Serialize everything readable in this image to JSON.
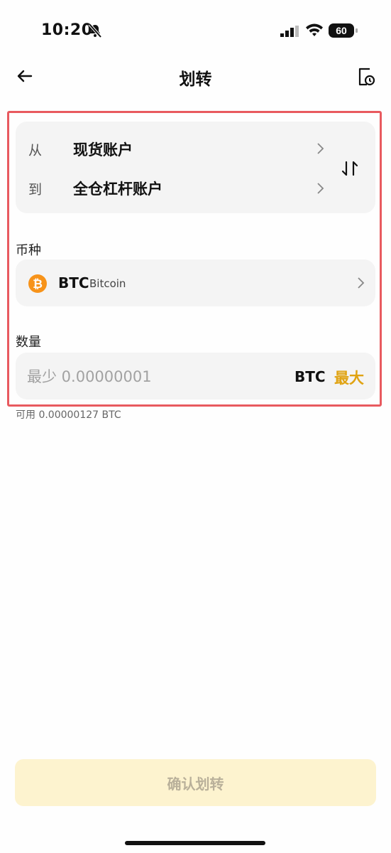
{
  "status_bar": {
    "time": "10:20",
    "battery": "60"
  },
  "header": {
    "title": "划转"
  },
  "transfer": {
    "from_label": "从",
    "from_account": "现货账户",
    "to_label": "到",
    "to_account": "全仓杠杆账户"
  },
  "currency": {
    "section_label": "币种",
    "code": "BTC",
    "name": "Bitcoin"
  },
  "amount": {
    "section_label": "数量",
    "value": "",
    "placeholder": "最少 0.00000001",
    "unit": "BTC",
    "max_label": "最大",
    "available": "可用 0.00000127 BTC"
  },
  "confirm_label": "确认划转",
  "colors": {
    "accent": "#e0a312",
    "highlight": "#e85a5f",
    "btc": "#f7931a",
    "confirm_bg": "#fdf3cf"
  },
  "icons": [
    "bell-slash-icon",
    "signal-icon",
    "wifi-icon",
    "battery-icon",
    "back-arrow-icon",
    "history-icon",
    "chevron-right-icon",
    "swap-icon",
    "bitcoin-icon"
  ]
}
